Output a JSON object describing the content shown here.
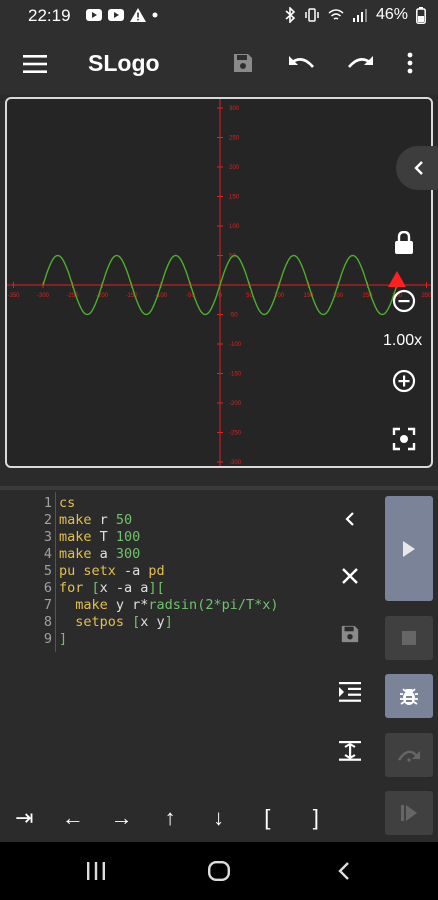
{
  "status_bar": {
    "time": "22:19",
    "battery": "46%",
    "left_icons": [
      "youtube-icon",
      "youtube-icon",
      "warning-icon",
      "dot-icon"
    ],
    "right_icons": [
      "bluetooth-icon",
      "vibrate-icon",
      "wifi-icon",
      "signal-icon",
      "battery-icon"
    ]
  },
  "app_bar": {
    "title": "SLogo",
    "icons": [
      "menu-icon",
      "save-icon",
      "undo-icon",
      "redo-icon",
      "more-vert-icon"
    ]
  },
  "canvas": {
    "zoom_label": "1.00x",
    "x_ticks": [
      "-350",
      "-300",
      "-250",
      "-200",
      "-150",
      "-100",
      "-50",
      "0",
      "50",
      "100",
      "150",
      "200",
      "250",
      "300",
      "350"
    ],
    "y_ticks": [
      "300",
      "250",
      "200",
      "150",
      "100",
      "50",
      "0",
      "-50",
      "-100",
      "-150",
      "-200",
      "-250",
      "-300"
    ],
    "curve": {
      "amplitude": 50,
      "period": 100,
      "x_start": -300,
      "x_end": 300
    },
    "colors": {
      "axis": "#e02020",
      "curve": "#4caf2c",
      "turtle": "#ff2020",
      "frame": "#d9d9d9"
    }
  },
  "editor": {
    "line_numbers": [
      "1",
      "2",
      "3",
      "4",
      "5",
      "6",
      "7",
      "8",
      "9"
    ],
    "lines": [
      [
        {
          "t": "cs",
          "c": "kw"
        }
      ],
      [
        {
          "t": "make",
          "c": "kw"
        },
        {
          "t": " r ",
          "c": ""
        },
        {
          "t": "50",
          "c": "num"
        }
      ],
      [
        {
          "t": "make",
          "c": "kw"
        },
        {
          "t": " T ",
          "c": ""
        },
        {
          "t": "100",
          "c": "num"
        }
      ],
      [
        {
          "t": "make",
          "c": "kw"
        },
        {
          "t": " a ",
          "c": ""
        },
        {
          "t": "300",
          "c": "num"
        }
      ],
      [
        {
          "t": "pu setx",
          "c": "kw"
        },
        {
          "t": " -a ",
          "c": ""
        },
        {
          "t": "pd",
          "c": "kw"
        }
      ],
      [
        {
          "t": "for",
          "c": "kw"
        },
        {
          "t": " [",
          "c": "br"
        },
        {
          "t": "x -a a",
          "c": ""
        },
        {
          "t": "][",
          "c": "br"
        }
      ],
      [
        {
          "t": "  make",
          "c": "kw"
        },
        {
          "t": " y r*",
          "c": ""
        },
        {
          "t": "radsin",
          "c": "fn"
        },
        {
          "t": "(2*",
          "c": "br"
        },
        {
          "t": "pi",
          "c": "fn"
        },
        {
          "t": "/T*x)",
          "c": "br"
        }
      ],
      [
        {
          "t": "  setpos",
          "c": "kw"
        },
        {
          "t": " [",
          "c": "br"
        },
        {
          "t": "x y",
          "c": ""
        },
        {
          "t": "]",
          "c": "br"
        }
      ],
      [
        {
          "t": "]",
          "c": "br"
        }
      ]
    ]
  },
  "editor_tools": [
    "chevron-left-icon",
    "close-icon",
    "save-icon",
    "indent-icon",
    "collapse-icon"
  ],
  "run_controls": [
    "play-icon",
    "stop-icon",
    "debug-icon",
    "step-over-icon",
    "step-icon"
  ],
  "key_bar": [
    "⇥",
    "←",
    "→",
    "↑",
    "↓",
    "[",
    "]"
  ],
  "nav_bar": [
    "recents-icon",
    "home-icon",
    "back-icon"
  ]
}
